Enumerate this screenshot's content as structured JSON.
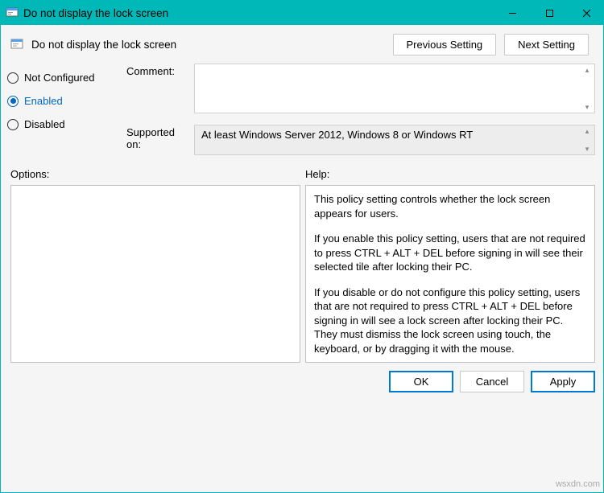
{
  "window": {
    "title": "Do not display the lock screen",
    "policy_name": "Do not display the lock screen"
  },
  "nav": {
    "previous": "Previous Setting",
    "next": "Next Setting"
  },
  "state": {
    "not_configured": "Not Configured",
    "enabled": "Enabled",
    "disabled": "Disabled",
    "selected": "enabled"
  },
  "meta": {
    "comment_label": "Comment:",
    "comment_value": "",
    "supported_label": "Supported on:",
    "supported_value": "At least Windows Server 2012, Windows 8 or Windows RT"
  },
  "sections": {
    "options_label": "Options:",
    "help_label": "Help:"
  },
  "help": {
    "p1": "This policy setting controls whether the lock screen appears for users.",
    "p2": "If you enable this policy setting, users that are not required to press CTRL + ALT + DEL before signing in will see their selected tile after locking their PC.",
    "p3": "If you disable or do not configure this policy setting, users that are not required to press CTRL + ALT + DEL before signing in will see a lock screen after locking their PC. They must dismiss the lock screen using touch, the keyboard, or by dragging it with the mouse."
  },
  "footer": {
    "ok": "OK",
    "cancel": "Cancel",
    "apply": "Apply"
  },
  "watermark": "wsxdn.com"
}
